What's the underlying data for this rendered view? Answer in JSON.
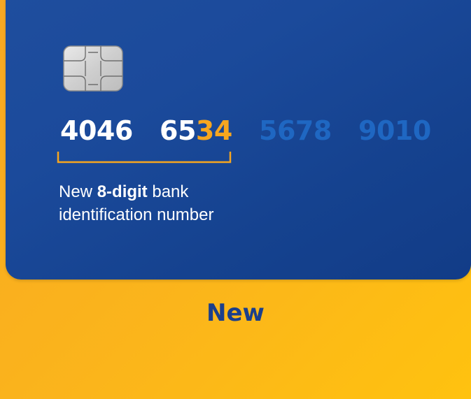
{
  "card": {
    "number_groups": [
      {
        "plain": "4046",
        "highlight": ""
      },
      {
        "plain": "65",
        "highlight": "34"
      },
      {
        "plain": "5678",
        "highlight": ""
      },
      {
        "plain": "9010",
        "highlight": ""
      }
    ],
    "caption": {
      "prefix": "New ",
      "bold": "8-digit",
      "suffix": " bank",
      "line2": "identification number"
    }
  },
  "label": "New",
  "colors": {
    "background": "#fbb51b",
    "card": "#1b4a9b",
    "highlight": "#f7a61f",
    "muted_digits": "#1f67c2",
    "label_text": "#1b3f8c"
  },
  "icons": {
    "chip": "emv-chip-icon"
  }
}
